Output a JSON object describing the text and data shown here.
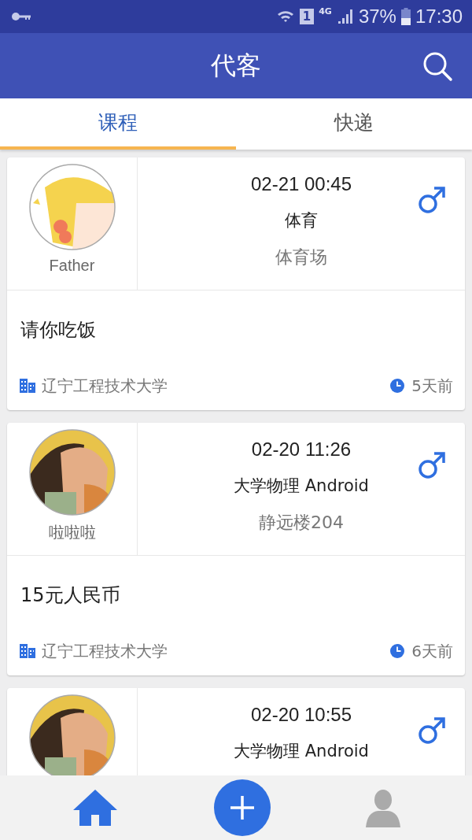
{
  "status_bar": {
    "sim": "1",
    "network": "4G",
    "battery": "37%",
    "time": "17:30"
  },
  "header": {
    "title": "代客"
  },
  "tabs": [
    {
      "label": "课程",
      "selected": true
    },
    {
      "label": "快递",
      "selected": false
    }
  ],
  "cards": [
    {
      "name": "Father",
      "time": "02-21 00:45",
      "course": "体育",
      "place": "体育场",
      "message": "请你吃饭",
      "school": "辽宁工程技术大学",
      "ago": "5天前"
    },
    {
      "name": "啦啦啦",
      "time": "02-20 11:26",
      "course": "大学物理 Android",
      "place": "静远楼204",
      "message": "15元人民币",
      "school": "辽宁工程技术大学",
      "ago": "6天前"
    },
    {
      "time": "02-20 10:55",
      "course": "大学物理 Android"
    }
  ]
}
